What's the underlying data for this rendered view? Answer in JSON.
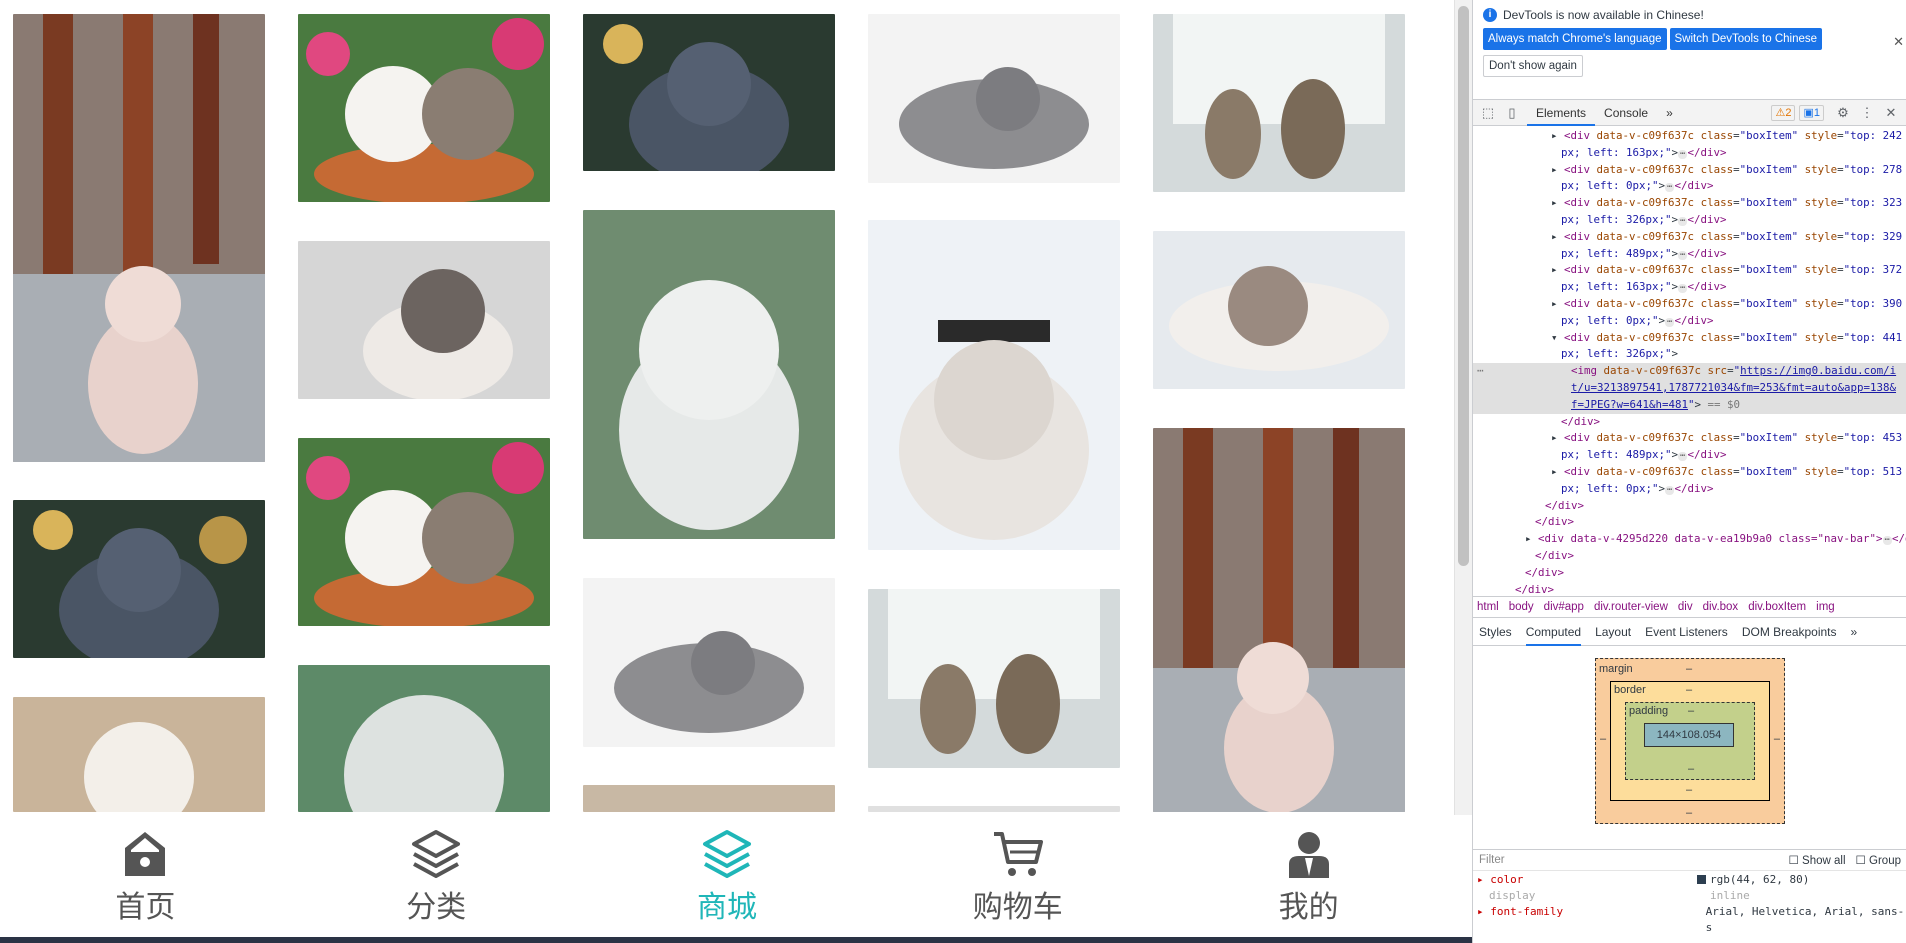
{
  "app": {
    "nav": [
      {
        "label": "首页",
        "icon": "home-icon",
        "active": false
      },
      {
        "label": "分类",
        "icon": "layers-icon",
        "active": false
      },
      {
        "label": "商城",
        "icon": "layers-icon",
        "active": true
      },
      {
        "label": "购物车",
        "icon": "cart-icon",
        "active": false
      },
      {
        "label": "我的",
        "icon": "user-icon",
        "active": false
      }
    ],
    "accent_color": "#1fb6b8"
  },
  "devtools": {
    "banner_text": "DevTools is now available in Chinese!",
    "btn_match": "Always match Chrome's language",
    "btn_switch": "Switch DevTools to Chinese",
    "btn_dont": "Don't show again",
    "tabs": [
      "Elements",
      "Console"
    ],
    "warn_count": "2",
    "msg_count": "1",
    "crumbs": [
      "html",
      "body",
      "div#app",
      "div.router-view",
      "div",
      "div.box",
      "div.boxItem",
      "img"
    ],
    "subtabs": [
      "Styles",
      "Computed",
      "Layout",
      "Event Listeners",
      "DOM Breakpoints"
    ],
    "box": {
      "margin": "margin",
      "border": "border",
      "padding": "padding",
      "content": "144×108.054",
      "dash": "–"
    },
    "filter_placeholder": "Filter",
    "show_all": "Show all",
    "group": "Group",
    "props": [
      {
        "name": "color",
        "value": "rgb(44, 62, 80)"
      },
      {
        "name": "display",
        "value": "inline"
      },
      {
        "name": "font-family",
        "value": "Arial, Helvetica, Arial, sans-s"
      }
    ],
    "code": {
      "attr_name": "data-v-c09f637c",
      "cls": "class=\"boxItem\"",
      "img_src": "https://img0.baidu.com/it/u=3213897541,1787721034&fm=253&fmt=auto&app=138&f=JPEG?w=641&h=481",
      "eq": "== $0",
      "nav_div": "<div data-v-4295d220 data-v-ea19b9a0 class=\"nav-bar\">"
    }
  }
}
